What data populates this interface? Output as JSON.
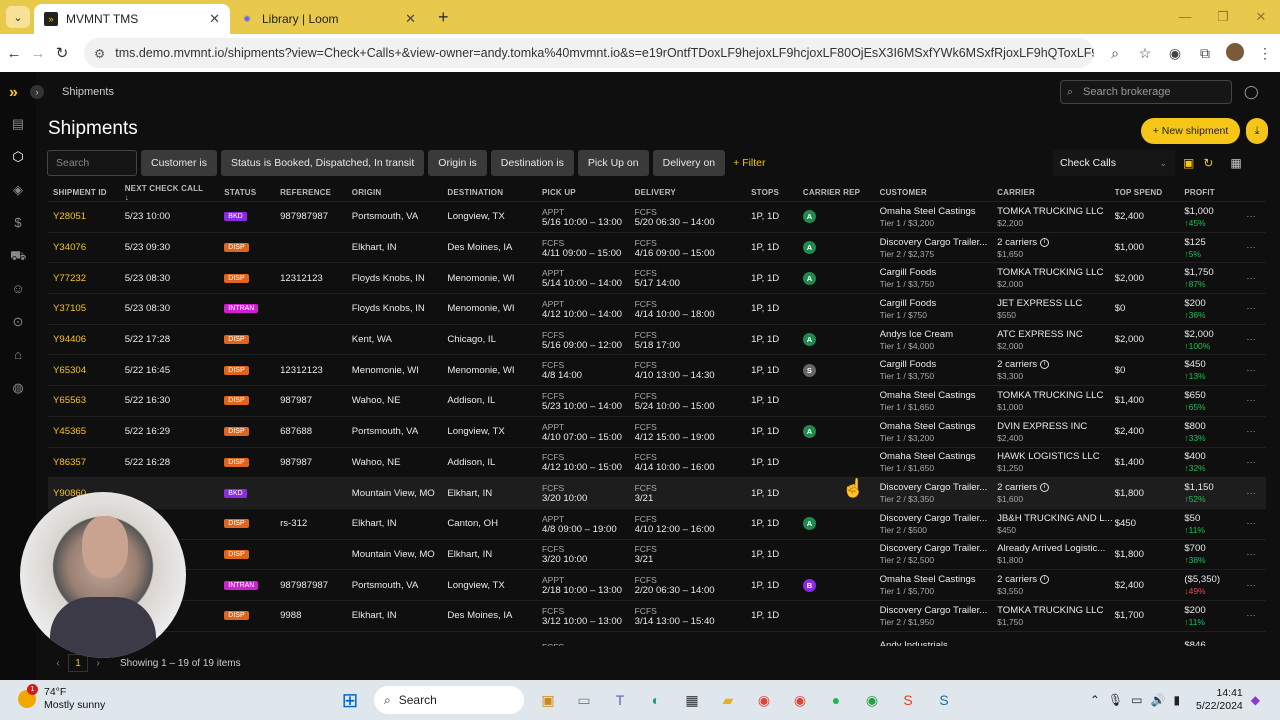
{
  "browser": {
    "tabs": [
      {
        "title": "MVMNT TMS",
        "active": true
      },
      {
        "title": "Library | Loom",
        "active": false
      }
    ],
    "url": "tms.demo.mvmnt.io/shipments?view=Check+Calls+&view-owner=andy.tomka%40mvmnt.io&s=e19rOntfTDoxLF9hejoxLF9hcjoxLF80OjEsX3I6MSxfYWk6MSxfRjoxLF9hQToxLF9oOjEsX..."
  },
  "app": {
    "breadcrumb": "Shipments",
    "search_placeholder": "Search brokerage",
    "page_title": "Shipments",
    "new_shipment": "New shipment",
    "filters": {
      "search_placeholder": "Search",
      "chips": [
        "Customer is",
        "Status is Booked, Dispatched, In transit",
        "Origin is",
        "Destination is",
        "Pick Up on",
        "Delivery on"
      ],
      "add_filter": "+ Filter"
    },
    "view_select": "Check Calls",
    "columns": [
      "SHIPMENT ID",
      "NEXT CHECK CALL",
      "STATUS",
      "REFERENCE",
      "ORIGIN",
      "DESTINATION",
      "PICK UP",
      "DELIVERY",
      "STOPS",
      "CARRIER REP",
      "CUSTOMER",
      "CARRIER",
      "TOP SPEND",
      "PROFIT"
    ],
    "rows": [
      {
        "id": "Y28051",
        "next": "5/23 10:00",
        "status": "BKD",
        "ref": "987987987",
        "origin": "Portsmouth, VA",
        "dest": "Longview, TX",
        "pu1": "APPT",
        "pu2": "5/16 10:00 – 13:00",
        "del1": "FCFS",
        "del2": "5/20 06:30 – 14:00",
        "stops": "1P, 1D",
        "rep": "A",
        "cust1": "Omaha Steel Castings",
        "cust2": "Tier 1 / $3,200",
        "carr1": "TOMKA TRUCKING LLC",
        "carr2": "$2,200",
        "carr_info": false,
        "spend": "$2,400",
        "profit": "$1,000",
        "pct": "↑45%",
        "pct_dir": "ok"
      },
      {
        "id": "Y34076",
        "next": "5/23 09:30",
        "status": "DISP",
        "ref": "",
        "origin": "Elkhart, IN",
        "dest": "Des Moines, IA",
        "pu1": "FCFS",
        "pu2": "4/11 09:00 – 15:00",
        "del1": "FCFS",
        "del2": "4/16 09:00 – 15:00",
        "stops": "1P, 1D",
        "rep": "A",
        "cust1": "Discovery Cargo Trailer...",
        "cust2": "Tier 2 / $2,375",
        "carr1": "2 carriers",
        "carr2": "$1,650",
        "carr_info": true,
        "spend": "$1,000",
        "profit": "$125",
        "pct": "↑5%",
        "pct_dir": "ok"
      },
      {
        "id": "Y77232",
        "next": "5/23 08:30",
        "status": "DISP",
        "ref": "12312123",
        "origin": "Floyds Knobs, IN",
        "dest": "Menomonie, WI",
        "pu1": "APPT",
        "pu2": "5/14 10:00 – 14:00",
        "del1": "FCFS",
        "del2": "5/17 14:00",
        "stops": "1P, 1D",
        "rep": "A",
        "cust1": "Cargill Foods",
        "cust2": "Tier 1 / $3,750",
        "carr1": "TOMKA TRUCKING LLC",
        "carr2": "$2,000",
        "carr_info": false,
        "spend": "$2,000",
        "profit": "$1,750",
        "pct": "↑87%",
        "pct_dir": "ok"
      },
      {
        "id": "Y37105",
        "next": "5/23 08:30",
        "status": "INTRAN",
        "ref": "",
        "origin": "Floyds Knobs, IN",
        "dest": "Menomonie, WI",
        "pu1": "APPT",
        "pu2": "4/12 10:00 – 14:00",
        "del1": "FCFS",
        "del2": "4/14 10:00 – 18:00",
        "stops": "1P, 1D",
        "rep": "",
        "cust1": "Cargill Foods",
        "cust2": "Tier 1 / $750",
        "carr1": "JET EXPRESS LLC",
        "carr2": "$550",
        "carr_info": false,
        "spend": "$0",
        "profit": "$200",
        "pct": "↑36%",
        "pct_dir": "ok"
      },
      {
        "id": "Y94406",
        "next": "5/22 17:28",
        "status": "DISP",
        "ref": "",
        "origin": "Kent, WA",
        "dest": "Chicago, IL",
        "pu1": "FCFS",
        "pu2": "5/16 09:00 – 12:00",
        "del1": "FCFS",
        "del2": "5/18 17:00",
        "stops": "1P, 1D",
        "rep": "A",
        "cust1": "Andys Ice Cream",
        "cust2": "Tier 1 / $4,000",
        "carr1": "ATC EXPRESS INC",
        "carr2": "$2,000",
        "carr_info": false,
        "spend": "$2,000",
        "profit": "$2,000",
        "pct": "↑100%",
        "pct_dir": "ok"
      },
      {
        "id": "Y65304",
        "next": "5/22 16:45",
        "status": "DISP",
        "ref": "12312123",
        "origin": "Menomonie, WI",
        "dest": "Menomonie, WI",
        "pu1": "FCFS",
        "pu2": "4/8 14:00",
        "del1": "FCFS",
        "del2": "4/10 13:00 – 14:30",
        "stops": "1P, 1D",
        "rep": "S",
        "cust1": "Cargill Foods",
        "cust2": "Tier 1 / $3,750",
        "carr1": "2 carriers",
        "carr2": "$3,300",
        "carr_info": true,
        "spend": "$0",
        "profit": "$450",
        "pct": "↑13%",
        "pct_dir": "ok"
      },
      {
        "id": "Y65563",
        "next": "5/22 16:30",
        "status": "DISP",
        "ref": "987987",
        "origin": "Wahoo, NE",
        "dest": "Addison, IL",
        "pu1": "FCFS",
        "pu2": "5/23 10:00 – 14:00",
        "del1": "FCFS",
        "del2": "5/24 10:00 – 15:00",
        "stops": "1P, 1D",
        "rep": "",
        "cust1": "Omaha Steel Castings",
        "cust2": "Tier 1 / $1,650",
        "carr1": "TOMKA TRUCKING LLC",
        "carr2": "$1,000",
        "carr_info": false,
        "spend": "$1,400",
        "profit": "$650",
        "pct": "↑65%",
        "pct_dir": "ok"
      },
      {
        "id": "Y45365",
        "next": "5/22 16:29",
        "status": "DISP",
        "ref": "687688",
        "origin": "Portsmouth, VA",
        "dest": "Longview, TX",
        "pu1": "APPT",
        "pu2": "4/10 07:00 – 15:00",
        "del1": "FCFS",
        "del2": "4/12 15:00 – 19:00",
        "stops": "1P, 1D",
        "rep": "A",
        "cust1": "Omaha Steel Castings",
        "cust2": "Tier 1 / $3,200",
        "carr1": "DVIN EXPRESS INC",
        "carr2": "$2,400",
        "carr_info": false,
        "spend": "$2,400",
        "profit": "$800",
        "pct": "↑33%",
        "pct_dir": "ok"
      },
      {
        "id": "Y86357",
        "next": "5/22 16:28",
        "status": "DISP",
        "ref": "987987",
        "origin": "Wahoo, NE",
        "dest": "Addison, IL",
        "pu1": "FCFS",
        "pu2": "4/12 10:00 – 15:00",
        "del1": "FCFS",
        "del2": "4/14 10:00 – 16:00",
        "stops": "1P, 1D",
        "rep": "",
        "cust1": "Omaha Steel Castings",
        "cust2": "Tier 1 / $1,650",
        "carr1": "HAWK LOGISTICS LLC",
        "carr2": "$1,250",
        "carr_info": false,
        "spend": "$1,400",
        "profit": "$400",
        "pct": "↑32%",
        "pct_dir": "ok"
      },
      {
        "id": "Y90860",
        "next": "",
        "status": "BKD",
        "ref": "",
        "origin": "Mountain View, MO",
        "dest": "Elkhart, IN",
        "pu1": "FCFS",
        "pu2": "3/20 10:00",
        "del1": "FCFS",
        "del2": "3/21",
        "stops": "1P, 1D",
        "rep": "",
        "cust1": "Discovery Cargo Trailer...",
        "cust2": "Tier 2 / $3,350",
        "carr1": "2 carriers",
        "carr2": "$1,600",
        "carr_info": true,
        "spend": "$1,800",
        "profit": "$1,150",
        "pct": "↑52%",
        "pct_dir": "ok",
        "highlight": true
      },
      {
        "id": "",
        "next": "",
        "status": "DISP",
        "ref": "rs-312",
        "origin": "Elkhart, IN",
        "dest": "Canton, OH",
        "pu1": "APPT",
        "pu2": "4/8 09:00 – 19:00",
        "del1": "FCFS",
        "del2": "4/10 12:00 – 16:00",
        "stops": "1P, 1D",
        "rep": "A",
        "cust1": "Discovery Cargo Trailer...",
        "cust2": "Tier 2 / $500",
        "carr1": "JB&H TRUCKING AND L...",
        "carr2": "$450",
        "carr_info": false,
        "spend": "$450",
        "profit": "$50",
        "pct": "↑11%",
        "pct_dir": "ok"
      },
      {
        "id": "",
        "next": "",
        "status": "DISP",
        "ref": "",
        "origin": "Mountain View, MO",
        "dest": "Elkhart, IN",
        "pu1": "FCFS",
        "pu2": "3/20 10:00",
        "del1": "FCFS",
        "del2": "3/21",
        "stops": "1P, 1D",
        "rep": "",
        "cust1": "Discovery Cargo Trailer...",
        "cust2": "Tier 2 / $2,500",
        "carr1": "Already Arrived Logistic...",
        "carr2": "$1,800",
        "carr_info": false,
        "spend": "$1,800",
        "profit": "$700",
        "pct": "↑38%",
        "pct_dir": "ok"
      },
      {
        "id": "",
        "next": "",
        "status": "INTRAN",
        "ref": "987987987",
        "origin": "Portsmouth, VA",
        "dest": "Longview, TX",
        "pu1": "APPT",
        "pu2": "2/18 10:00 – 13:00",
        "del1": "FCFS",
        "del2": "2/20 06:30 – 14:00",
        "stops": "1P, 1D",
        "rep": "B",
        "cust1": "Omaha Steel Castings",
        "cust2": "Tier 1 / $5,700",
        "carr1": "2 carriers",
        "carr2": "$3,550",
        "carr_info": true,
        "spend": "$2,400",
        "profit": "($5,350)",
        "pct": "↓49%",
        "pct_dir": "bad"
      },
      {
        "id": "",
        "next": "",
        "status": "DISP",
        "ref": "9988",
        "origin": "Elkhart, IN",
        "dest": "Des Moines, IA",
        "pu1": "FCFS",
        "pu2": "3/12 10:00 – 13:00",
        "del1": "FCFS",
        "del2": "3/14 13:00 – 15:40",
        "stops": "1P, 1D",
        "rep": "",
        "cust1": "Discovery Cargo Trailer...",
        "cust2": "Tier 2 / $1,950",
        "carr1": "TOMKA TRUCKING LLC",
        "carr2": "$1,750",
        "carr_info": false,
        "spend": "$1,700",
        "profit": "$200",
        "pct": "↑11%",
        "pct_dir": "ok"
      },
      {
        "id": "",
        "next": "",
        "status": "",
        "ref": "",
        "origin": "",
        "dest": "",
        "pu1": "FCFS",
        "pu2": "",
        "del1": "",
        "del2": "",
        "stops": "",
        "rep": "",
        "cust1": "Andy Industrials",
        "cust2": "",
        "carr1": "",
        "carr2": "",
        "carr_info": false,
        "spend": "",
        "profit": "$846",
        "pct": "",
        "pct_dir": "ok"
      }
    ],
    "pager": {
      "page": "1",
      "summary": "Showing 1 – 19 of 19 items"
    }
  },
  "taskbar": {
    "weather_temp": "74°F",
    "weather_desc": "Mostly sunny",
    "weather_badge": "1",
    "search": "Search",
    "time": "14:41",
    "date": "5/22/2024"
  },
  "colors": {
    "accent": "#f5c518",
    "disp": "#e0651c",
    "bkd": "#8a2be2",
    "intran": "#d21ed2"
  }
}
